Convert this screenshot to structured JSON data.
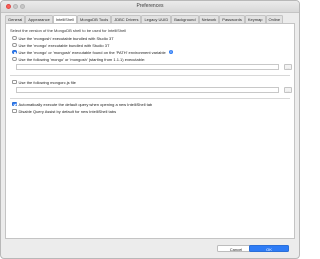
{
  "window": {
    "title": "Preferences"
  },
  "tabs": [
    {
      "label": "General"
    },
    {
      "label": "Appearance"
    },
    {
      "label": "IntelliShell"
    },
    {
      "label": "MongoDB Tools"
    },
    {
      "label": "JDBC Drivers"
    },
    {
      "label": "Legacy UUID"
    },
    {
      "label": "Background"
    },
    {
      "label": "Network"
    },
    {
      "label": "Passwords"
    },
    {
      "label": "Keymap"
    },
    {
      "label": "Online"
    }
  ],
  "active_tab": "IntelliShell",
  "shell_section": {
    "title": "Select the version of the MongoDB shell to be used for IntelliShell",
    "options": [
      {
        "label": "Use the 'mongosh' executable bundled with Studio 3T",
        "selected": false
      },
      {
        "label": "Use the 'mongo' executable bundled with Studio 3T",
        "selected": false
      },
      {
        "label": "Use the 'mongo' or 'mongosh' executable found on the 'PATH' environment variable",
        "selected": true
      },
      {
        "label": "Use the following 'mongo' or 'mongosh' (starting from 1.1.1) executable:",
        "selected": false
      }
    ],
    "browse_label": "..."
  },
  "mongorc": {
    "label": "Use the following mongorc.js file",
    "checked": false,
    "browse_label": "..."
  },
  "auto_execute": {
    "label": "Automatically execute the default query when opening a new IntelliShell tab",
    "checked": true
  },
  "query_assist": {
    "label": "Disable Query Assist by default for new IntelliShell tabs",
    "checked": false
  },
  "buttons": {
    "cancel": "Cancel",
    "ok": "OK"
  },
  "colors": {
    "accent": "#2e7cf6",
    "close": "#fc5f57"
  }
}
